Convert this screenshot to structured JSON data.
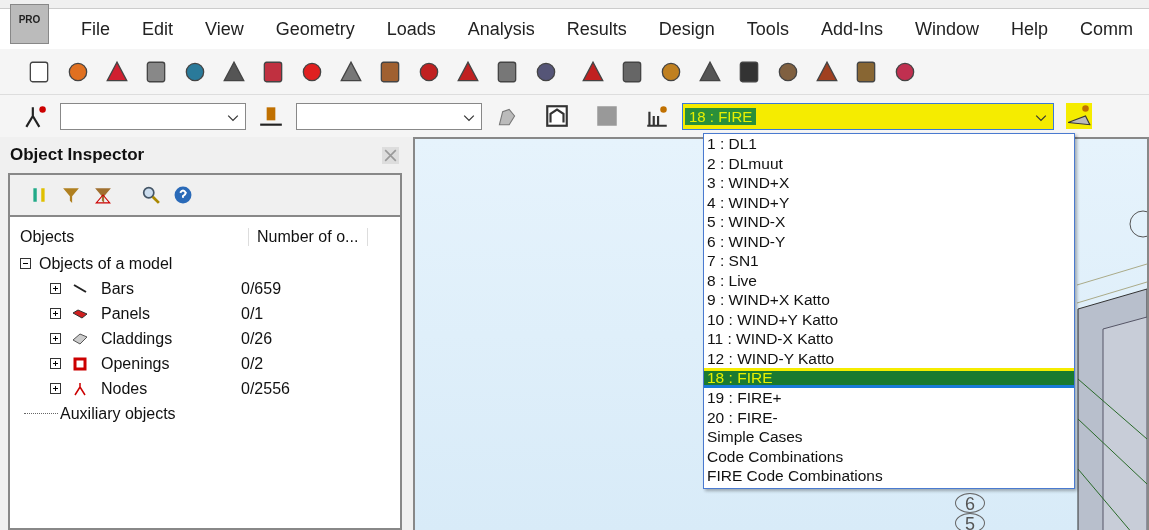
{
  "app_badge": "PRO",
  "menu": [
    "File",
    "Edit",
    "View",
    "Geometry",
    "Loads",
    "Analysis",
    "Results",
    "Design",
    "Tools",
    "Add-Ins",
    "Window",
    "Help",
    "Comm"
  ],
  "load_case_combo": {
    "value": "18 : FIRE",
    "expanded": true,
    "options": [
      {
        "label": "1 : DL1",
        "selected": false
      },
      {
        "label": "2 : DLmuut",
        "selected": false
      },
      {
        "label": "3 : WIND+X",
        "selected": false
      },
      {
        "label": "4 : WIND+Y",
        "selected": false
      },
      {
        "label": "5 : WIND-X",
        "selected": false
      },
      {
        "label": "6 : WIND-Y",
        "selected": false
      },
      {
        "label": "7 : SN1",
        "selected": false
      },
      {
        "label": "8 : Live",
        "selected": false
      },
      {
        "label": "9 : WIND+X Katto",
        "selected": false
      },
      {
        "label": "10 : WIND+Y Katto",
        "selected": false
      },
      {
        "label": "11 : WIND-X Katto",
        "selected": false
      },
      {
        "label": "12 : WIND-Y Katto",
        "selected": false
      },
      {
        "label": "18 : FIRE",
        "selected": true
      },
      {
        "label": "19 : FIRE+",
        "selected": false
      },
      {
        "label": "20 : FIRE-",
        "selected": false
      },
      {
        "label": "Simple Cases",
        "selected": false
      },
      {
        "label": "Code Combinations",
        "selected": false
      },
      {
        "label": "FIRE Code Combinations",
        "selected": false
      }
    ]
  },
  "object_inspector": {
    "title": "Object Inspector",
    "columns": [
      "Objects",
      "Number of o..."
    ],
    "tree": [
      {
        "label": "Objects of a model",
        "expanded": true,
        "children": [
          {
            "label": "Bars",
            "count": "0/659",
            "kind": "bar",
            "expanded": false
          },
          {
            "label": "Panels",
            "count": "0/1",
            "kind": "panel",
            "expanded": false
          },
          {
            "label": "Claddings",
            "count": "0/26",
            "kind": "cladding",
            "expanded": false
          },
          {
            "label": "Openings",
            "count": "0/2",
            "kind": "opening",
            "expanded": false
          },
          {
            "label": "Nodes",
            "count": "0/2556",
            "kind": "node",
            "expanded": false
          }
        ]
      },
      {
        "label": "Auxiliary objects"
      }
    ]
  },
  "viewport": {
    "grid_labels": [
      "6",
      "5"
    ]
  }
}
